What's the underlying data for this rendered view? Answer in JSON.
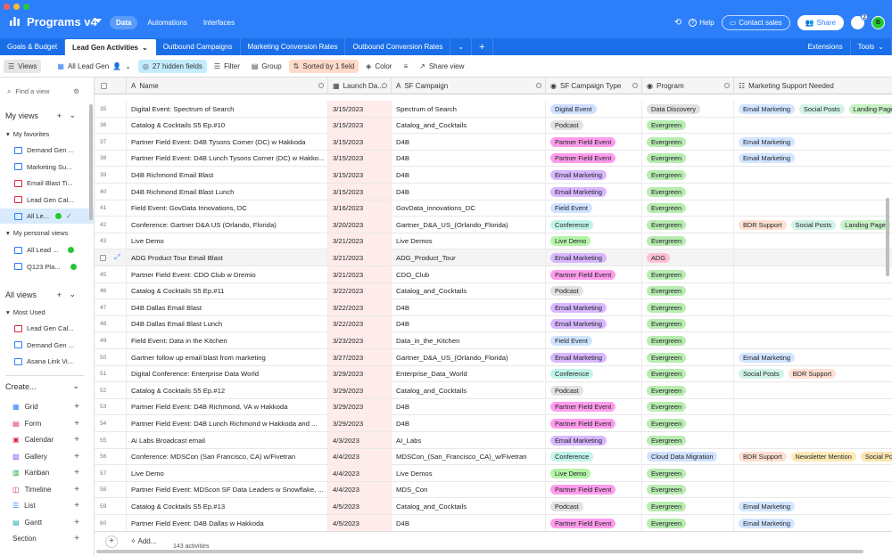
{
  "app": {
    "title": "Programs v4",
    "nav": [
      "Data",
      "Automations",
      "Interfaces"
    ],
    "help": "Help",
    "contact_sales": "Contact sales",
    "share": "Share",
    "notif_count": "2",
    "avatar_initial": "B",
    "brand_color": "#2d7ff9"
  },
  "tabs": {
    "items": [
      "Goals & Budget",
      "Lead Gen Activities",
      "Outbound Campaigns",
      "Marketing Conversion Rates",
      "Outbound Conversion Rates"
    ],
    "active_index": 1,
    "extensions": "Extensions",
    "tools": "Tools"
  },
  "toolbar": {
    "views": "Views",
    "current_view": "All Lead Gen",
    "hidden_fields": "27 hidden fields",
    "filter": "Filter",
    "group": "Group",
    "sorted": "Sorted by 1 field",
    "color": "Color",
    "share_view": "Share view"
  },
  "sidebar": {
    "find_placeholder": "Find a view",
    "my_views": "My views",
    "my_favorites": "My favorites",
    "favorites": [
      "Demand Gen ...",
      "Marketing Su...",
      "Email Blast Ti...",
      "Lead Gen Cal...",
      "All Le..."
    ],
    "my_personal_views": "My personal views",
    "personal": [
      "All Lead ...",
      "Q123 Pla..."
    ],
    "all_views": "All views",
    "most_used": "Most Used",
    "most_used_items": [
      "Lead Gen Cal...",
      "Demand Gen ...",
      "Asana Link Vi..."
    ],
    "create": "Create...",
    "create_items": [
      "Grid",
      "Form",
      "Calendar",
      "Gallery",
      "Kanban",
      "Timeline",
      "List",
      "Gantt",
      "Section"
    ]
  },
  "grid": {
    "columns": [
      "Name",
      "Launch Da...",
      "SF Campaign",
      "SF Campaign Type",
      "Program",
      "Marketing Support Needed"
    ],
    "rows": [
      {
        "n": "35",
        "name": "Digital Event: Spectrum of Search",
        "date": "3/15/2023",
        "camp": "Spectrum of Search",
        "type": "Digital Event",
        "prog": "Data Discovery",
        "ms": [
          "Email Marketing",
          "Social Posts",
          "Landing Page"
        ]
      },
      {
        "n": "36",
        "name": "Catalog & Cocktails S5 Ep.#10",
        "date": "3/15/2023",
        "camp": "Catalog_and_Cocktails",
        "type": "Podcast",
        "prog": "Evergreen",
        "ms": []
      },
      {
        "n": "37",
        "name": "Partner Field Event: D4B Tysons Corner (DC) w Hakkoda",
        "date": "3/15/2023",
        "camp": "D4B",
        "type": "Partner Field Event",
        "prog": "Evergreen",
        "ms": [
          "Email Marketing"
        ]
      },
      {
        "n": "38",
        "name": "Partner Field Event: D4B Lunch Tysons Corner (DC) w Hakko...",
        "date": "3/15/2023",
        "camp": "D4B",
        "type": "Partner Field Event",
        "prog": "Evergreen",
        "ms": [
          "Email Marketing"
        ]
      },
      {
        "n": "39",
        "name": "D4B Richmond Email Blast",
        "date": "3/15/2023",
        "camp": "D4B",
        "type": "Email Marketing",
        "prog": "Evergreen",
        "ms": []
      },
      {
        "n": "40",
        "name": "D4B Richmond Email Blast Lunch",
        "date": "3/15/2023",
        "camp": "D4B",
        "type": "Email Marketing",
        "prog": "Evergreen",
        "ms": []
      },
      {
        "n": "41",
        "name": "Field Event: GovData Innovations, DC",
        "date": "3/16/2023",
        "camp": "GovData_innovations_DC",
        "type": "Field Event",
        "prog": "Evergreen",
        "ms": []
      },
      {
        "n": "42",
        "name": "Conference: Gartner D&A US (Orlando, Florida)",
        "date": "3/20/2023",
        "camp": "Gartner_D&A_US_(Orlando_Florida)",
        "type": "Conference",
        "prog": "Evergreen",
        "ms": [
          "BDR Support",
          "Social Posts",
          "Landing Page"
        ]
      },
      {
        "n": "43",
        "name": "Live Demo",
        "date": "3/21/2023",
        "camp": "Live Demos",
        "type": "Live Demo",
        "prog": "Evergreen",
        "ms": []
      },
      {
        "n": "",
        "name": "ADG Product Tour Email Blast",
        "date": "3/21/2023",
        "camp": "ADG_Product_Tour",
        "type": "Email Marketing",
        "prog": "ADG",
        "ms": []
      },
      {
        "n": "45",
        "name": "Partner Field Event: CDO Club w Dremio",
        "date": "3/21/2023",
        "camp": "CDO_Club",
        "type": "Partner Field Event",
        "prog": "Evergreen",
        "ms": []
      },
      {
        "n": "46",
        "name": "Catalog & Cocktails S5 Ep.#11",
        "date": "3/22/2023",
        "camp": "Catalog_and_Cocktails",
        "type": "Podcast",
        "prog": "Evergreen",
        "ms": []
      },
      {
        "n": "47",
        "name": "D4B Dallas Email Blast",
        "date": "3/22/2023",
        "camp": "D4B",
        "type": "Email Marketing",
        "prog": "Evergreen",
        "ms": []
      },
      {
        "n": "48",
        "name": "D4B Dallas Email Blast Lunch",
        "date": "3/22/2023",
        "camp": "D4B",
        "type": "Email Marketing",
        "prog": "Evergreen",
        "ms": []
      },
      {
        "n": "49",
        "name": "Field Event: Data in the Kitchen",
        "date": "3/23/2023",
        "camp": "Data_in_the_Kitchen",
        "type": "Field Event",
        "prog": "Evergreen",
        "ms": []
      },
      {
        "n": "50",
        "name": "Gartner follow up email blast from marketing",
        "date": "3/27/2023",
        "camp": "Gartner_D&A_US_(Orlando_Florida)",
        "type": "Email Marketing",
        "prog": "Evergreen",
        "ms": [
          "Email Marketing"
        ]
      },
      {
        "n": "51",
        "name": "Digital Conference: Enterprise Data World",
        "date": "3/29/2023",
        "camp": "Enterprise_Data_World",
        "type": "Conference",
        "prog": "Evergreen",
        "ms": [
          "Social Posts",
          "BDR Support"
        ]
      },
      {
        "n": "52",
        "name": "Catalog & Cocktails S5 Ep.#12",
        "date": "3/29/2023",
        "camp": "Catalog_and_Cocktails",
        "type": "Podcast",
        "prog": "Evergreen",
        "ms": []
      },
      {
        "n": "53",
        "name": "Partner Field Event: D4B Richmond, VA w Hakkoda",
        "date": "3/29/2023",
        "camp": "D4B",
        "type": "Partner Field Event",
        "prog": "Evergreen",
        "ms": []
      },
      {
        "n": "54",
        "name": "Partner Field Event: D4B Lunch Richmond w Hakkoda and ...",
        "date": "3/29/2023",
        "camp": "D4B",
        "type": "Partner Field Event",
        "prog": "Evergreen",
        "ms": []
      },
      {
        "n": "55",
        "name": "Ai Labs Broadcast email",
        "date": "4/3/2023",
        "camp": "AI_Labs",
        "type": "Email Marketing",
        "prog": "Evergreen",
        "ms": []
      },
      {
        "n": "56",
        "name": "Conference: MDSCon (San Francisco, CA) w/Fivetran",
        "date": "4/4/2023",
        "camp": "MDSCon_(San_Francisco_CA)_w/Fivetran",
        "type": "Conference",
        "prog": "Cloud Data Migration",
        "ms": [
          "BDR Support",
          "Newsletter Mention",
          "Social Po"
        ]
      },
      {
        "n": "57",
        "name": "Live Demo",
        "date": "4/4/2023",
        "camp": "Live Demos",
        "type": "Live Demo",
        "prog": "Evergreen",
        "ms": []
      },
      {
        "n": "58",
        "name": "Partner Field Event: MDScon SF Data Leaders w Snowflake, ...",
        "date": "4/4/2023",
        "camp": "MDS_Con",
        "type": "Partner Field Event",
        "prog": "Evergreen",
        "ms": []
      },
      {
        "n": "59",
        "name": "Catalog & Cocktails S5 Ep.#13",
        "date": "4/5/2023",
        "camp": "Catalog_and_Cocktails",
        "type": "Podcast",
        "prog": "Evergreen",
        "ms": [
          "Email Marketing"
        ]
      },
      {
        "n": "60",
        "name": "Partner Field Event: D4B Dallas w Hakkoda",
        "date": "4/5/2023",
        "camp": "D4B",
        "type": "Partner Field Event",
        "prog": "Evergreen",
        "ms": [
          "Email Marketing"
        ]
      }
    ],
    "add_label": "Add...",
    "count": "143 activities"
  }
}
